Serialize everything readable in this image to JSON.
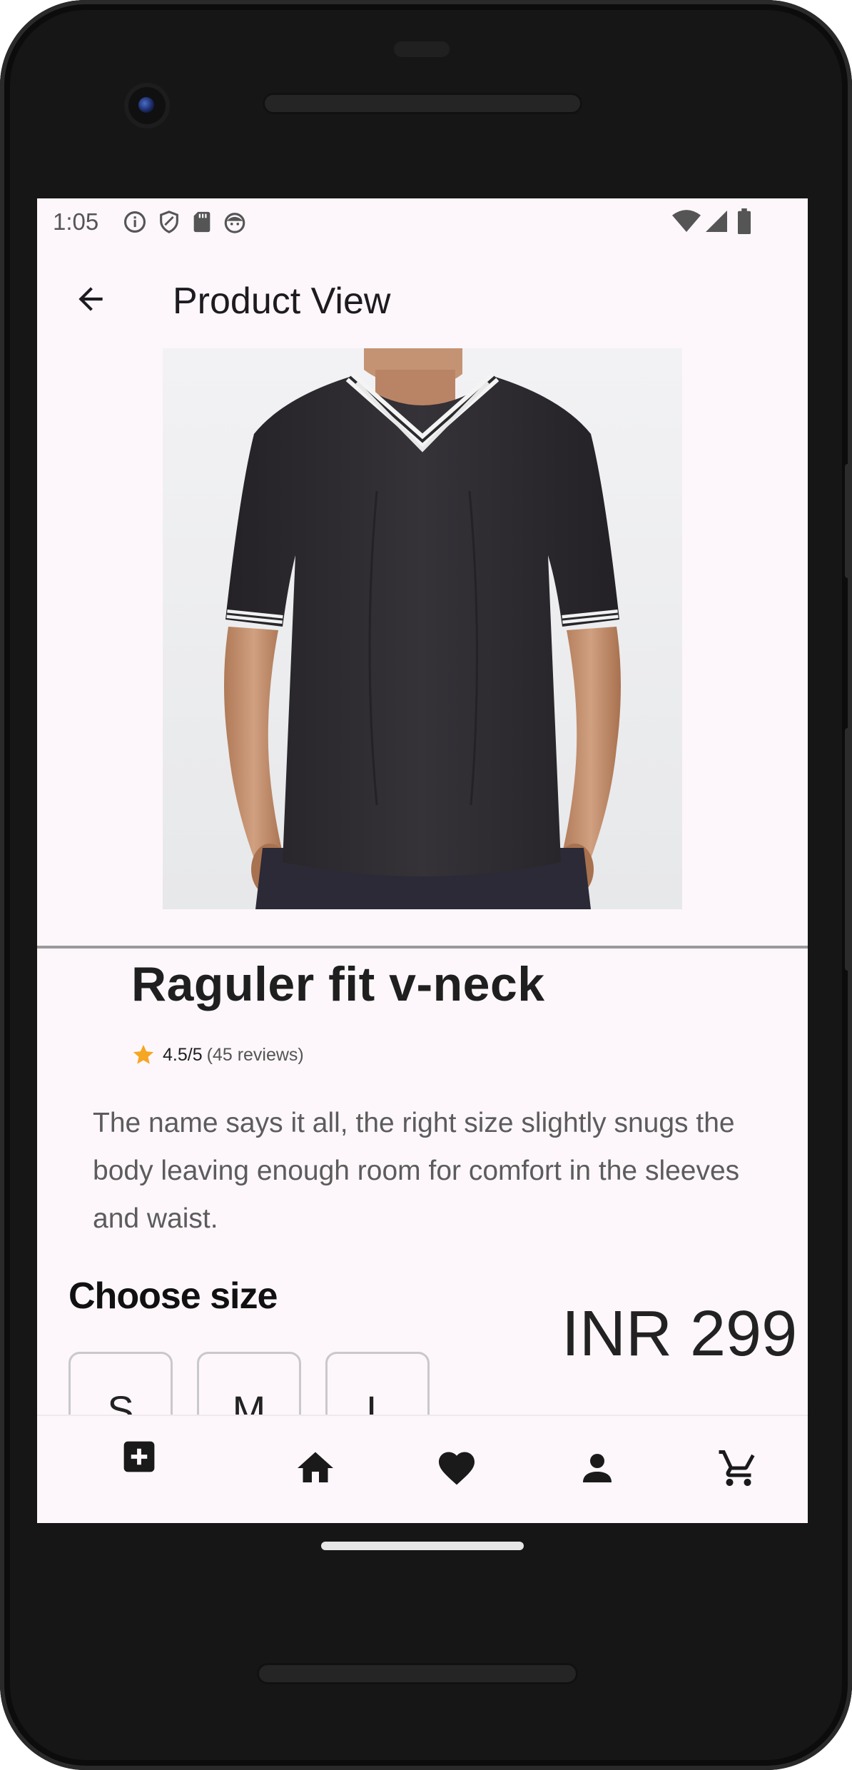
{
  "status_bar": {
    "time": "1:05"
  },
  "app_bar": {
    "title": "Product View"
  },
  "product": {
    "name": "Raguler fit v-neck",
    "rating": "4.5/5",
    "reviews": "(45 reviews)",
    "description": "The name says it all, the right size slightly snugs the body leaving enough room for comfort in the sleeves and waist.",
    "price": "INR 299"
  },
  "size_section": {
    "heading": "Choose size",
    "options": [
      "S",
      "M",
      "L"
    ]
  },
  "bottom_nav": {
    "items": [
      "add-icon",
      "home-icon",
      "favorite-icon",
      "profile-icon",
      "cart-icon"
    ]
  },
  "colors": {
    "screen_bg": "#fdf7fb",
    "star": "#f5a623",
    "tshirt": "#2d2b2e"
  }
}
